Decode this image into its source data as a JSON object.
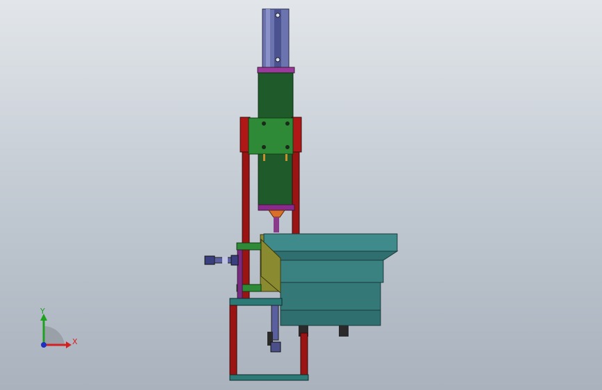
{
  "viewport": {
    "background_top": "#e2e6ea",
    "background_bottom": "#a9b2bd"
  },
  "triad": {
    "x_label": "X",
    "y_label": "Y",
    "x_color": "#d42020",
    "y_color": "#20a020",
    "z_color": "#2030c0"
  },
  "model": {
    "colors": {
      "cylinder_body": "#2b6a3a",
      "cylinder_rod": "#6a70a0",
      "plate_green": "#2e8a36",
      "frame_red": "#9a1414",
      "frame_purple": "#7a2a80",
      "base_teal": "#2c7a78",
      "bowl_teal": "#3f8a8a",
      "bracket_olive": "#8a8a30",
      "dark_block": "#2a2a2a"
    }
  }
}
